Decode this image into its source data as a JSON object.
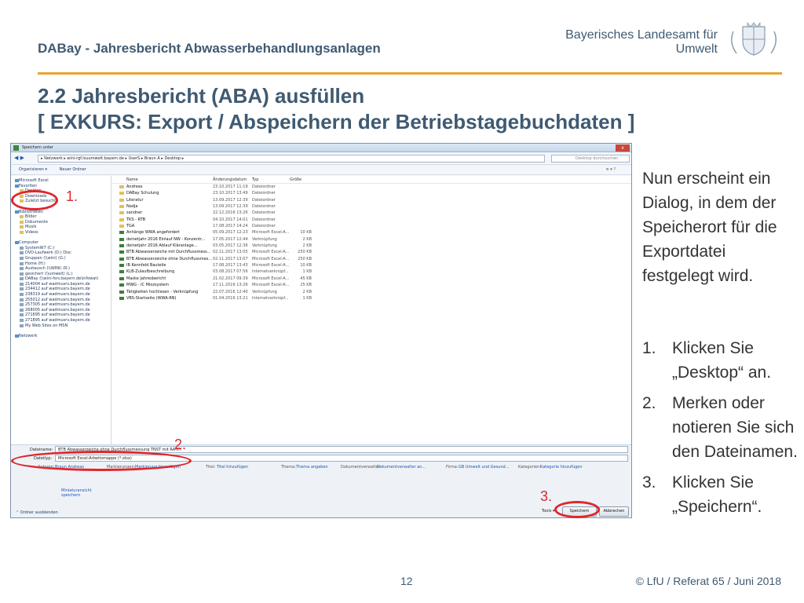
{
  "header": {
    "title": "DABay - Jahresbericht Abwasserbehandlungsanlagen",
    "agency_line1": "Bayerisches Landesamt für",
    "agency_line2": "Umwelt",
    "accent_color": "#e8a532"
  },
  "main_title": {
    "line1": "2.2 Jahresbericht (ABA) ausfüllen",
    "line2": "[ EXKURS: Export / Abspeichern der Betriebstagebuchdaten ]"
  },
  "dialog": {
    "window_title": "Speichern unter",
    "close_label": "x",
    "address_path": "▸ Netzwerk ▸ wini-rgf.Isuumwelt.bayern.de ▸ UserS ▸ Braun A ▸ Desktop ▸",
    "search_placeholder": "Desktop durchsuchen",
    "toolbar": {
      "organize": "Organisieren ▾",
      "new_folder": "Neuer Ordner",
      "view_controls": "≡ ▾  ?"
    },
    "nav_items": [
      {
        "label": "Microsoft Excel",
        "kind": "grp"
      },
      {
        "label": "Favoriten",
        "kind": "grp"
      },
      {
        "label": "Desktop",
        "kind": "item"
      },
      {
        "label": "Downloads",
        "kind": "item"
      },
      {
        "label": "Zuletzt besucht",
        "kind": "item"
      },
      {
        "label": "",
        "kind": "gap"
      },
      {
        "label": "Bibliotheken",
        "kind": "grp"
      },
      {
        "label": "Bilder",
        "kind": "item"
      },
      {
        "label": "Dokumente",
        "kind": "item"
      },
      {
        "label": "Musik",
        "kind": "item"
      },
      {
        "label": "Videos",
        "kind": "item"
      },
      {
        "label": "",
        "kind": "gap"
      },
      {
        "label": "Computer",
        "kind": "grp"
      },
      {
        "label": "SystemW7 (C:)",
        "kind": "drv"
      },
      {
        "label": "DVD-Laufwerk (D:) Disc",
        "kind": "drv"
      },
      {
        "label": "Gruppen (\\\\wini) (G:)",
        "kind": "drv"
      },
      {
        "label": "Home (H:)",
        "kind": "drv"
      },
      {
        "label": "Austausch (\\\\WINI) (R:)",
        "kind": "drv"
      },
      {
        "label": "gesichert (\\\\umwelt) (L:)",
        "kind": "drv"
      },
      {
        "label": "DABay (\\\\wini-fsrv.bayern.de\\infowat)",
        "kind": "drv"
      },
      {
        "label": "214004 auf wadmusrv.bayern.de",
        "kind": "drv"
      },
      {
        "label": "234412 auf wadmusrv.bayern.de",
        "kind": "drv"
      },
      {
        "label": "238319 auf wadmusrv.bayern.de",
        "kind": "drv"
      },
      {
        "label": "255012 auf wadmusrv.bayern.de",
        "kind": "drv"
      },
      {
        "label": "257305 auf wadmusrv.bayern.de",
        "kind": "drv"
      },
      {
        "label": "268005 auf wadmusrv.bayern.de",
        "kind": "drv"
      },
      {
        "label": "271695 auf wadmusrv.bayern.de",
        "kind": "drv"
      },
      {
        "label": "271895 auf wadmusrv.bayern.de",
        "kind": "drv"
      },
      {
        "label": "My Web Sites on MSN",
        "kind": "drv"
      },
      {
        "label": "",
        "kind": "gap"
      },
      {
        "label": "Netzwerk",
        "kind": "grp"
      }
    ],
    "columns": {
      "name": "Name",
      "date": "Änderungsdatum",
      "type": "Typ",
      "size": "Größe"
    },
    "files": [
      {
        "name": "Andreas",
        "date": "23.10.2017 11:19",
        "type": "Dateiordner",
        "size": "",
        "kind": "folder"
      },
      {
        "name": "DABay Schulung",
        "date": "23.10.2017 13:49",
        "type": "Dateiordner",
        "size": "",
        "kind": "folder"
      },
      {
        "name": "Literatur",
        "date": "13.09.2017 12:39",
        "type": "Dateiordner",
        "size": "",
        "kind": "folder"
      },
      {
        "name": "Nadja",
        "date": "13.09.2017 12:39",
        "type": "Dateiordner",
        "size": "",
        "kind": "folder"
      },
      {
        "name": "sandner",
        "date": "22.12.2016 13:26",
        "type": "Dateiordner",
        "size": "",
        "kind": "folder"
      },
      {
        "name": "TKS - RTB",
        "date": "04.10.2017 14:01",
        "type": "Dateiordner",
        "size": "",
        "kind": "folder"
      },
      {
        "name": "TGA",
        "date": "17.08.2017 14:24",
        "type": "Dateiordner",
        "size": "",
        "kind": "folder"
      },
      {
        "name": "Anhänge WWA angefordert",
        "date": "05.09.2017 12:23",
        "type": "Microsoft Excel-A...",
        "size": "10 KB",
        "kind": "doc"
      },
      {
        "name": "deinetjahr 2016 Einlauf NW - Konzentr...",
        "date": "17.05.2017 12:44",
        "type": "Verknüpfung",
        "size": "2 KB",
        "kind": "doc"
      },
      {
        "name": "deinetjahr 2016 Ablauf Kläranlage...",
        "date": "03.05.2017 12:36",
        "type": "Verknüpfung",
        "size": "2 KB",
        "kind": "doc"
      },
      {
        "name": "BTB Abwasserzeiche mit Durchflussmess...",
        "date": "02.11.2017 13:05",
        "type": "Microsoft Excel-A...",
        "size": "250 KB",
        "kind": "doc"
      },
      {
        "name": "BTB Abwasserzeiche ohne Durchflussmes...",
        "date": "02.11.2017 13:07",
        "type": "Microsoft Excel-A...",
        "size": "250 KB",
        "kind": "doc"
      },
      {
        "name": "IB Kennfeld Bauteile",
        "date": "17.08.2017 13:43",
        "type": "Microsoft Excel-A...",
        "size": "10 KB",
        "kind": "doc"
      },
      {
        "name": "KLB-Zulaufbeschreibung",
        "date": "03.08.2017 07:56",
        "type": "Internetverknüpf...",
        "size": "1 KB",
        "kind": "doc"
      },
      {
        "name": "Maske Jahresbericht",
        "date": "21.02.2017 09:39",
        "type": "Microsoft Excel-A...",
        "size": "45 KB",
        "kind": "doc"
      },
      {
        "name": "MWG - IC Miozsystem",
        "date": "17.11.2016 13:26",
        "type": "Microsoft Excel-A...",
        "size": "25 KB",
        "kind": "doc"
      },
      {
        "name": "Tätigkeiten hochlesen - Verknüpfung",
        "date": "22.07.2016 12:40",
        "type": "Verknüpfung",
        "size": "2 KB",
        "kind": "doc"
      },
      {
        "name": "VBS-Startseite (WWA-RN)",
        "date": "01.04.2016 13:21",
        "type": "Internetverknüpf...",
        "size": "1 KB",
        "kind": "doc"
      }
    ],
    "save": {
      "filename_label": "Dateiname:",
      "filename_value": "BTB Abwasserzeiche ohne Durchflussmessung TNST mit RA-XY",
      "filetype_label": "Dateityp:",
      "filetype_value": "Microsoft Excel-Arbeitsmappe (*.xlsx)",
      "authors_label": "Autoren:",
      "authors_value": "Braun Andreas",
      "tags_label": "Markierungen:",
      "tags_value": "Markierung hinzufügen",
      "title_label": "Titel:",
      "title_value": "Titel hinzufügen",
      "subject_label": "Thema:",
      "subject_value": "Thema angeben",
      "manager_label": "Dokumentverwalter:",
      "manager_value": "Dokumentverwalter an...",
      "company_label": "Firma:",
      "company_value": "GB Umwelt und Gesund...",
      "categories_label": "Kategorien:",
      "categories_value": "Kategorie hinzufügen",
      "thumbnail_label": "Miniaturansicht speichern",
      "hide_folders": "⌃ Ordner ausblenden",
      "tools": "Tools ▾",
      "save_button": "Speichern",
      "cancel_button": "Abbrechen"
    }
  },
  "annotations": {
    "marker1": "1.",
    "marker2": "2.",
    "marker3": "3.",
    "color": "#e0262b"
  },
  "explanation": {
    "paragraph": "Nun erscheint ein Dialog, in dem der Speicherort für die Exportdatei festgelegt wird.",
    "steps": [
      {
        "num": "1.",
        "text": "Klicken Sie „Desktop“ an."
      },
      {
        "num": "2.",
        "text": "Merken oder notieren Sie sich den Dateinamen."
      },
      {
        "num": "3.",
        "text": "Klicken Sie „Speichern“."
      }
    ]
  },
  "footer": {
    "page_number": "12",
    "credit": "© LfU / Referat 65 / Juni 2018"
  }
}
